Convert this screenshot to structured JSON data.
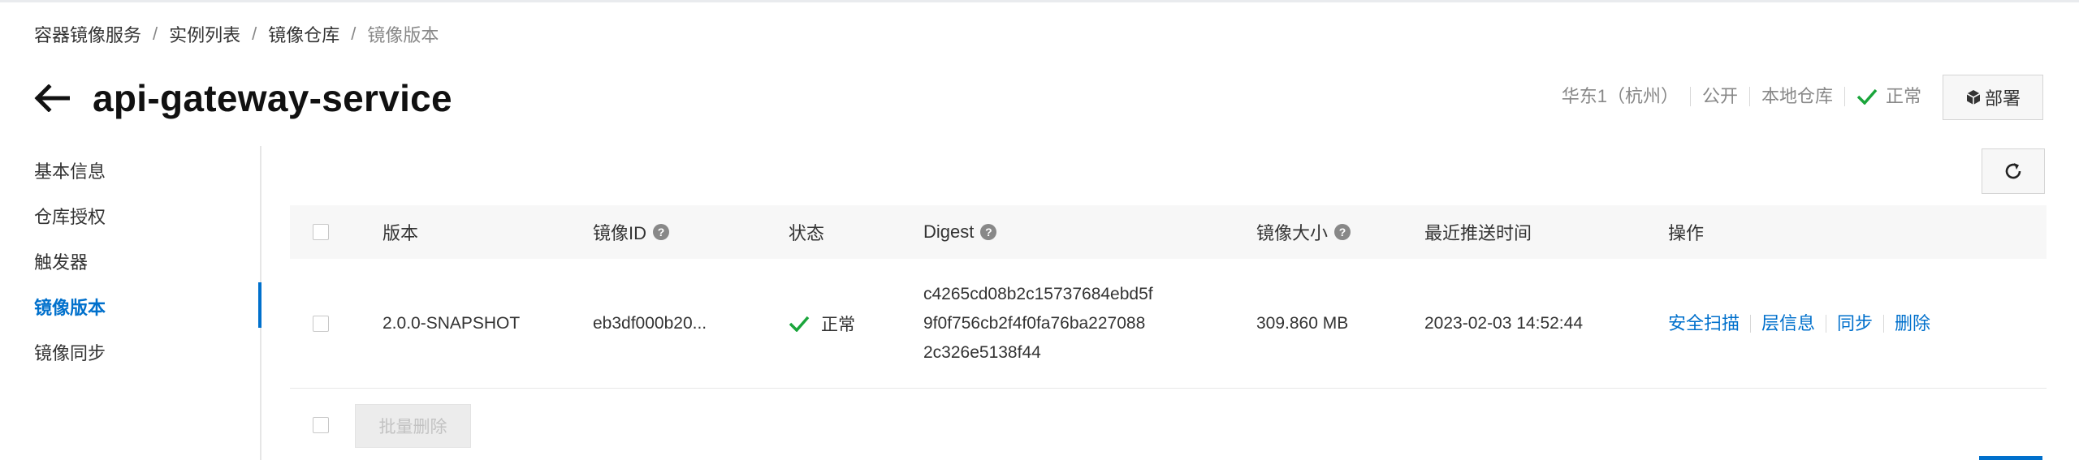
{
  "breadcrumb": {
    "items": [
      "容器镜像服务",
      "实例列表",
      "镜像仓库",
      "镜像版本"
    ],
    "separator": "/"
  },
  "header": {
    "title": "api-gateway-service",
    "region": "华东1（杭州）",
    "visibility": "公开",
    "repo_type": "本地仓库",
    "status": "正常",
    "deploy_label": "部署"
  },
  "sidebar": {
    "items": [
      {
        "label": "基本信息"
      },
      {
        "label": "仓库授权"
      },
      {
        "label": "触发器"
      },
      {
        "label": "镜像版本",
        "active": true
      },
      {
        "label": "镜像同步"
      }
    ]
  },
  "table": {
    "columns": {
      "version": "版本",
      "image_id": "镜像ID",
      "status": "状态",
      "digest": "Digest",
      "size": "镜像大小",
      "pushed_at": "最近推送时间",
      "actions": "操作"
    },
    "rows": [
      {
        "version": "2.0.0-SNAPSHOT",
        "image_id": "eb3df000b20...",
        "status": "正常",
        "digest_lines": [
          "c4265cd08b2c15737684ebd5f",
          "9f0f756cb2f4f0fa76ba227088",
          "2c326e5138f44"
        ],
        "size": "309.860 MB",
        "pushed_at": "2023-02-03 14:52:44",
        "actions": [
          "安全扫描",
          "层信息",
          "同步",
          "删除"
        ]
      }
    ]
  },
  "footer": {
    "batch_delete_label": "批量删除"
  },
  "colors": {
    "accent": "#0070cc",
    "success": "#1aa53b",
    "header_bg": "#f7f7f7"
  },
  "icons": {
    "back": "arrow-left-icon",
    "status": "check-icon",
    "deploy": "cube-icon",
    "refresh": "refresh-icon",
    "help": "question-circle-icon"
  }
}
